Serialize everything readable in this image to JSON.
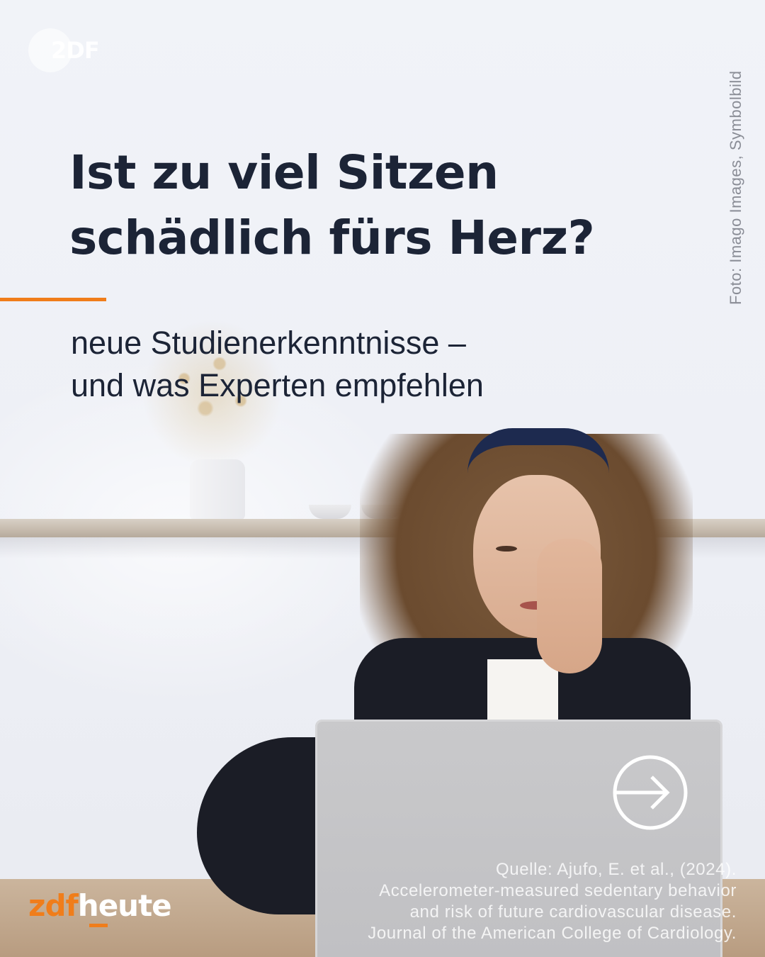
{
  "watermark": {
    "text": "2DF"
  },
  "headline": {
    "line1": "Ist zu viel Sitzen",
    "line2": "schädlich fürs Herz?"
  },
  "subline": {
    "line1": "neue Studienerkenntnisse –",
    "line2": "und was Experten empfehlen"
  },
  "credit": "Foto: Imago Images, Symbolbild",
  "next_button": {
    "icon": "arrow-right-circle-icon"
  },
  "source": {
    "line1": "Quelle: Ajufo, E. et al., (2024).",
    "line2": "Accelerometer-measured sedentary behavior",
    "line3": "and risk of future cardiovascular disease.",
    "line4": "Journal of the American College of Cardiology."
  },
  "brand": {
    "part1": "zdf",
    "part2": "heute"
  },
  "colors": {
    "accent": "#f07d1a",
    "headline": "#1c2436",
    "credit": "#8a8d96"
  }
}
